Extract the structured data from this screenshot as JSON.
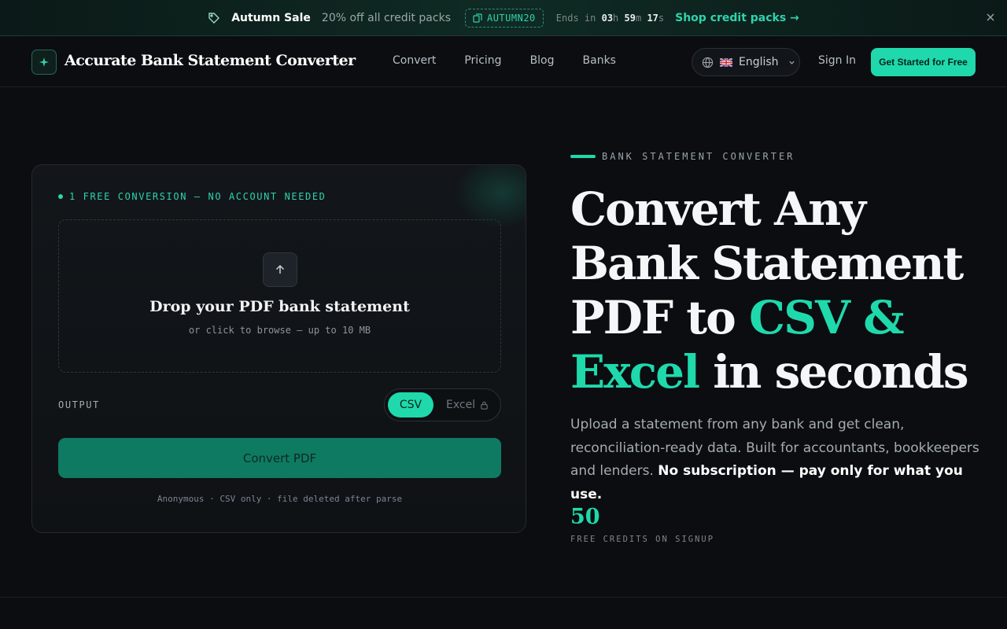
{
  "promo": {
    "title": "Autumn Sale",
    "text": "20% off all credit packs",
    "code": "AUTUMN20",
    "ends_label": "Ends in",
    "hours": "03",
    "hours_unit": "h",
    "minutes": "59",
    "minutes_unit": "m",
    "seconds": "17",
    "seconds_unit": "s",
    "link": "Shop credit packs →"
  },
  "header": {
    "brand": "Accurate Bank Statement Converter",
    "nav": [
      {
        "label": "Convert"
      },
      {
        "label": "Pricing"
      },
      {
        "label": "Blog"
      },
      {
        "label": "Banks"
      }
    ],
    "language": "English",
    "sign_in": "Sign In",
    "cta": "Get Started for Free"
  },
  "converter": {
    "badge": "1 FREE CONVERSION — NO ACCOUNT NEEDED",
    "drop_title": "Drop your PDF bank statement",
    "drop_sub": "or click to browse — up to 10 MB",
    "output_label": "OUTPUT",
    "formats": [
      {
        "label": "CSV",
        "selected": true
      },
      {
        "label": "Excel",
        "locked": true
      }
    ],
    "button": "Convert PDF",
    "footnote": "Anonymous · CSV only · file deleted after parse"
  },
  "hero": {
    "eyebrow": "BANK STATEMENT CONVERTER",
    "title_part1": "Convert Any Bank Statement PDF to ",
    "title_accent1": "CSV &",
    "title_accent2": "Excel",
    "title_part2": " in seconds",
    "subtitle": "Upload a statement from any bank and get clean, reconciliation-ready data. Built for accountants, bookkeepers and lenders. ",
    "subtitle_strong": "No subscription — pay only for what you use.",
    "stat_value": "50",
    "stat_label": "FREE CREDITS ON SIGNUP"
  },
  "colors": {
    "accent": "#1fd9ac",
    "background": "#0b0d10",
    "convert_button": "#0f7a62"
  }
}
